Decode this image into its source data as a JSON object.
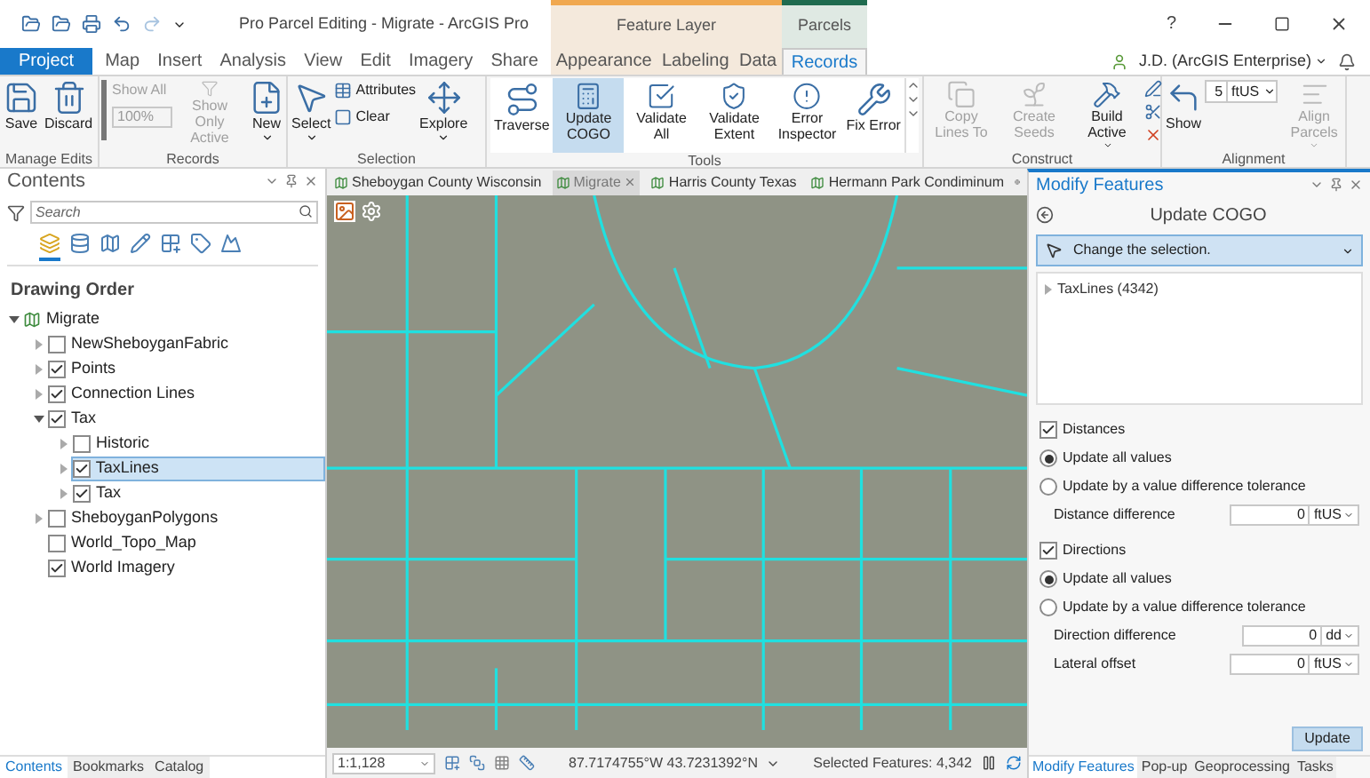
{
  "window": {
    "title": "Pro Parcel Editing - Migrate - ArcGIS Pro",
    "help": "?"
  },
  "contextual_headers": [
    {
      "label": "Feature Layer",
      "kind": "layer"
    },
    {
      "label": "Parcels",
      "kind": "parcel"
    }
  ],
  "tabs": [
    {
      "label": "Project",
      "kind": "file",
      "selected": false
    },
    {
      "label": "Map",
      "kind": "core",
      "selected": false
    },
    {
      "label": "Insert",
      "kind": "core",
      "selected": false
    },
    {
      "label": "Analysis",
      "kind": "core",
      "selected": false
    },
    {
      "label": "View",
      "kind": "core",
      "selected": false
    },
    {
      "label": "Edit",
      "kind": "core",
      "selected": false
    },
    {
      "label": "Imagery",
      "kind": "core",
      "selected": false
    },
    {
      "label": "Share",
      "kind": "core",
      "selected": false
    },
    {
      "label": "Appearance",
      "kind": "layer",
      "selected": false
    },
    {
      "label": "Labeling",
      "kind": "layer",
      "selected": false
    },
    {
      "label": "Data",
      "kind": "layer",
      "selected": false
    },
    {
      "label": "Records",
      "kind": "parcel",
      "selected": true
    }
  ],
  "account": {
    "user": "J.D. (ArcGIS Enterprise)"
  },
  "ribbon": [
    {
      "title": "Manage Edits",
      "kind": "plain",
      "items": [
        {
          "kind": "large",
          "label": "Save",
          "disabled": false,
          "selected": false,
          "dropdown": false
        },
        {
          "kind": "large",
          "label": "Discard",
          "disabled": false,
          "selected": false,
          "dropdown": false
        }
      ]
    },
    {
      "title": "Records",
      "kind": "plain",
      "items": [
        {
          "kind": "scale",
          "label": "Show All",
          "value": "100%",
          "disabled": true
        },
        {
          "kind": "large",
          "label": "Show Only Active",
          "disabled": true,
          "selected": false,
          "dropdown": false
        },
        {
          "kind": "large",
          "label": "New",
          "disabled": false,
          "selected": false,
          "dropdown": true
        }
      ]
    },
    {
      "title": "Selection",
      "kind": "plain",
      "items": [
        {
          "kind": "large",
          "label": "Select",
          "disabled": false,
          "selected": false,
          "dropdown": true
        },
        {
          "kind": "stack",
          "buttons": [
            {
              "label": "Attributes",
              "disabled": false
            },
            {
              "label": "Clear",
              "disabled": false
            }
          ]
        },
        {
          "kind": "large",
          "label": "Explore",
          "disabled": false,
          "selected": false,
          "dropdown": true
        }
      ]
    },
    {
      "title": "Tools",
      "kind": "gallery",
      "items": [
        {
          "kind": "large",
          "label": "Traverse",
          "disabled": false,
          "selected": false,
          "dropdown": false
        },
        {
          "kind": "large",
          "label": "Update COGO",
          "disabled": false,
          "selected": true,
          "dropdown": false
        },
        {
          "kind": "large",
          "label": "Validate All",
          "disabled": false,
          "selected": false,
          "dropdown": false
        },
        {
          "kind": "large",
          "label": "Validate Extent",
          "disabled": false,
          "selected": false,
          "dropdown": false
        },
        {
          "kind": "large",
          "label": "Error Inspector",
          "disabled": false,
          "selected": false,
          "dropdown": false
        },
        {
          "kind": "large",
          "label": "Fix Error",
          "disabled": false,
          "selected": false,
          "dropdown": false
        }
      ]
    },
    {
      "title": "Construct",
      "kind": "plain",
      "items": [
        {
          "kind": "large",
          "label": "Copy Lines To",
          "disabled": true,
          "selected": false,
          "dropdown": false
        },
        {
          "kind": "large",
          "label": "Create Seeds",
          "disabled": true,
          "selected": false,
          "dropdown": false
        },
        {
          "kind": "large",
          "label": "Build Active",
          "disabled": false,
          "selected": false,
          "dropdown": true
        },
        {
          "kind": "stack",
          "buttons": [
            {
              "disabled": false
            },
            {
              "disabled": false
            },
            {
              "disabled": false
            }
          ]
        }
      ]
    },
    {
      "title": "Alignment",
      "kind": "plain",
      "items": [
        {
          "kind": "large",
          "label": "Show",
          "disabled": false,
          "selected": false,
          "dropdown": false
        },
        {
          "kind": "spinner",
          "value": "5",
          "unit": "ftUS",
          "disabled": false
        },
        {
          "kind": "large",
          "label": "Align Parcels",
          "disabled": true,
          "selected": false,
          "dropdown": true
        }
      ]
    }
  ],
  "contents": {
    "title": "Contents",
    "search": {
      "placeholder": "Search"
    },
    "view_tabs": [
      {
        "selected": true
      },
      {
        "selected": false
      },
      {
        "selected": false
      },
      {
        "selected": false
      },
      {
        "selected": false
      },
      {
        "selected": false
      },
      {
        "selected": false
      }
    ],
    "heading": "Drawing Order",
    "tree": [
      {
        "kind": "map",
        "label": "Migrate",
        "expanded": true,
        "selected": false,
        "children": [
          {
            "kind": "layer",
            "label": "NewSheboyganFabric",
            "expanded": false,
            "checked": false,
            "selected": false
          },
          {
            "kind": "layer",
            "label": "Points",
            "expanded": false,
            "checked": true,
            "selected": false
          },
          {
            "kind": "layer",
            "label": "Connection Lines",
            "expanded": false,
            "checked": true,
            "selected": false
          },
          {
            "kind": "layer",
            "label": "Tax",
            "expanded": true,
            "checked": true,
            "selected": false,
            "children": [
              {
                "kind": "layer",
                "label": "Historic",
                "expanded": false,
                "checked": false,
                "selected": false
              },
              {
                "kind": "layer",
                "label": "TaxLines",
                "expanded": false,
                "checked": true,
                "selected": true
              },
              {
                "kind": "layer",
                "label": "Tax",
                "expanded": false,
                "checked": true,
                "selected": false
              }
            ]
          },
          {
            "kind": "layer",
            "label": "SheboyganPolygons",
            "expanded": false,
            "checked": false,
            "selected": false
          },
          {
            "kind": "layer",
            "label": "World_Topo_Map",
            "checked": false,
            "selected": false
          },
          {
            "kind": "layer",
            "label": "World Imagery",
            "checked": true,
            "selected": false
          }
        ]
      }
    ],
    "bottom_tabs": [
      {
        "label": "Contents",
        "selected": true
      },
      {
        "label": "Bookmarks",
        "selected": false
      },
      {
        "label": "Catalog",
        "selected": false
      }
    ]
  },
  "map": {
    "tabs": [
      {
        "label": "Sheboygan County Wisconsin",
        "selected": false
      },
      {
        "label": "Migrate",
        "selected": true
      },
      {
        "label": "Harris County Texas",
        "selected": false
      },
      {
        "label": "Hermann Park Condiminum",
        "selected": false
      }
    ],
    "scale": "1:1,128",
    "coordinates": "87.7174755°W 43.7231392°N",
    "selected_features": "Selected Features: 4,342"
  },
  "pane": {
    "title": "Modify Features",
    "tool": "Update COGO",
    "selection_prompt": "Change the selection.",
    "list": [
      {
        "label": "TaxLines (4342)",
        "expanded": false
      }
    ],
    "sections": [
      {
        "label": "Distances",
        "checked": true,
        "options": [
          {
            "label": "Update all values",
            "selected": true
          },
          {
            "label": "Update by a value difference tolerance",
            "selected": false
          }
        ],
        "fields": [
          {
            "label": "Distance difference",
            "value": "0",
            "unit": "ftUS"
          }
        ]
      },
      {
        "label": "Directions",
        "checked": true,
        "options": [
          {
            "label": "Update all values",
            "selected": true
          },
          {
            "label": "Update by a value difference tolerance",
            "selected": false
          }
        ],
        "fields": [
          {
            "label": "Direction difference",
            "value": "0",
            "unit": "dd"
          },
          {
            "label": "Lateral offset",
            "value": "0",
            "unit": "ftUS"
          }
        ]
      }
    ],
    "button": "Update",
    "bottom_tabs": [
      {
        "label": "Modify Features",
        "selected": true
      },
      {
        "label": "Pop-up",
        "selected": false
      },
      {
        "label": "Geoprocessing",
        "selected": false
      },
      {
        "label": "Tasks",
        "selected": false
      }
    ]
  }
}
